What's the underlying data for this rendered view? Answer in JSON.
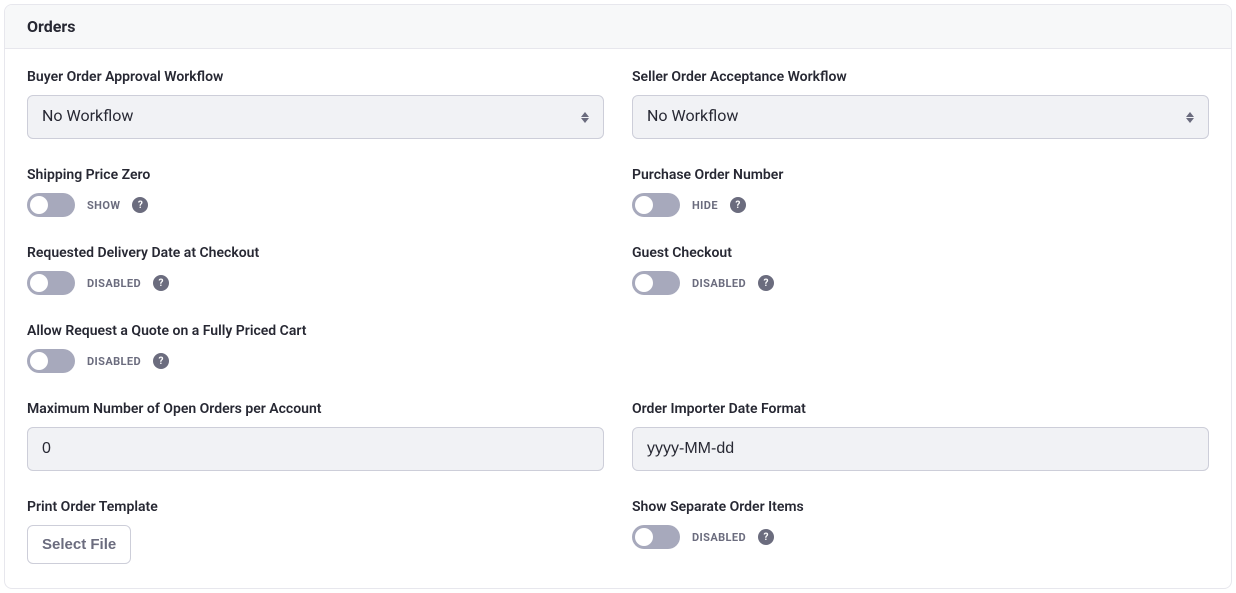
{
  "header": {
    "title": "Orders"
  },
  "buyerWorkflow": {
    "label": "Buyer Order Approval Workflow",
    "value": "No Workflow"
  },
  "sellerWorkflow": {
    "label": "Seller Order Acceptance Workflow",
    "value": "No Workflow"
  },
  "shippingPriceZero": {
    "label": "Shipping Price Zero",
    "state": "SHOW"
  },
  "purchaseOrderNumber": {
    "label": "Purchase Order Number",
    "state": "HIDE"
  },
  "requestedDelivery": {
    "label": "Requested Delivery Date at Checkout",
    "state": "DISABLED"
  },
  "guestCheckout": {
    "label": "Guest Checkout",
    "state": "DISABLED"
  },
  "allowQuote": {
    "label": "Allow Request a Quote on a Fully Priced Cart",
    "state": "DISABLED"
  },
  "maxOpenOrders": {
    "label": "Maximum Number of Open Orders per Account",
    "value": "0"
  },
  "dateFormat": {
    "label": "Order Importer Date Format",
    "value": "yyyy-MM-dd"
  },
  "printTemplate": {
    "label": "Print Order Template",
    "button": "Select File"
  },
  "separateItems": {
    "label": "Show Separate Order Items",
    "state": "DISABLED"
  },
  "icons": {
    "help": "?"
  }
}
